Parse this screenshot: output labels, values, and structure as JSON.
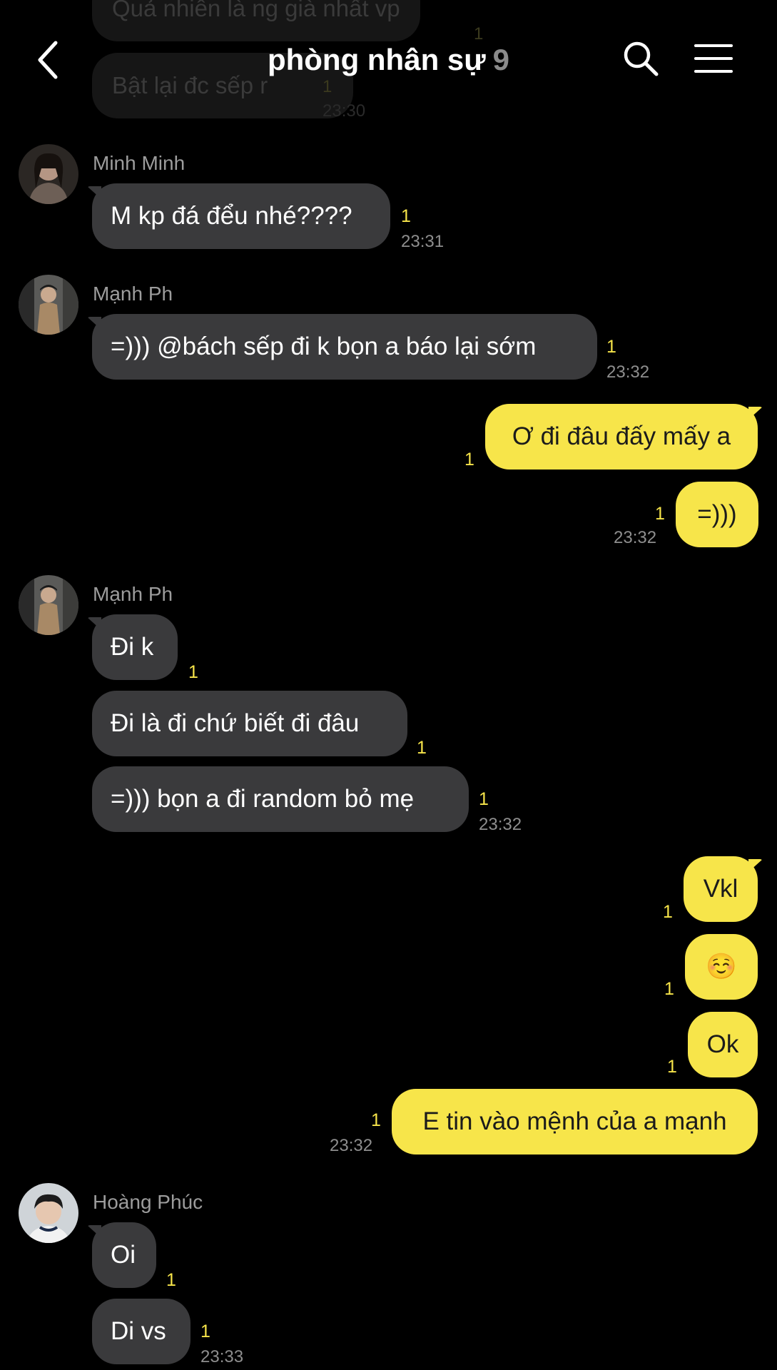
{
  "header": {
    "title": "phòng nhân sự",
    "member_count": "9",
    "back_icon": "chevron-left-icon",
    "search_icon": "search-icon",
    "menu_icon": "hamburger-menu-icon"
  },
  "ghost_messages": [
    {
      "text": "Quả nhiên là ng già nhất vp",
      "unread": "1"
    },
    {
      "text": "Bật lại đc sếp r",
      "unread": "1",
      "time": "23:30"
    }
  ],
  "messages": [
    {
      "sender": "Minh Minh",
      "text": "M kp đá đểu nhé????",
      "unread": "1",
      "time": "23:31"
    },
    {
      "sender": "Mạnh Ph",
      "text": "=))) @bách sếp đi k bọn a báo lại sớm",
      "unread": "1",
      "time": "23:32"
    },
    {
      "text": "Ơ đi đâu đấy mấy a",
      "unread": "1"
    },
    {
      "text": "=)))",
      "unread": "1",
      "time": "23:32"
    },
    {
      "sender": "Mạnh Ph",
      "text": "Đi k",
      "unread": "1"
    },
    {
      "text": "Đi là đi chứ biết đi đâu",
      "unread": "1"
    },
    {
      "text": "=))) bọn a đi random bỏ mẹ",
      "unread": "1",
      "time": "23:32"
    },
    {
      "text": "Vkl",
      "unread": "1"
    },
    {
      "text": "☺️",
      "unread": "1"
    },
    {
      "text": "Ok",
      "unread": "1"
    },
    {
      "text": "E tin vào mệnh của a mạnh",
      "unread": "1",
      "time": "23:32"
    },
    {
      "sender": "Hoàng Phúc",
      "text": "Oi",
      "unread": "1"
    },
    {
      "text": "Di vs",
      "unread": "1",
      "time": "23:33"
    }
  ]
}
